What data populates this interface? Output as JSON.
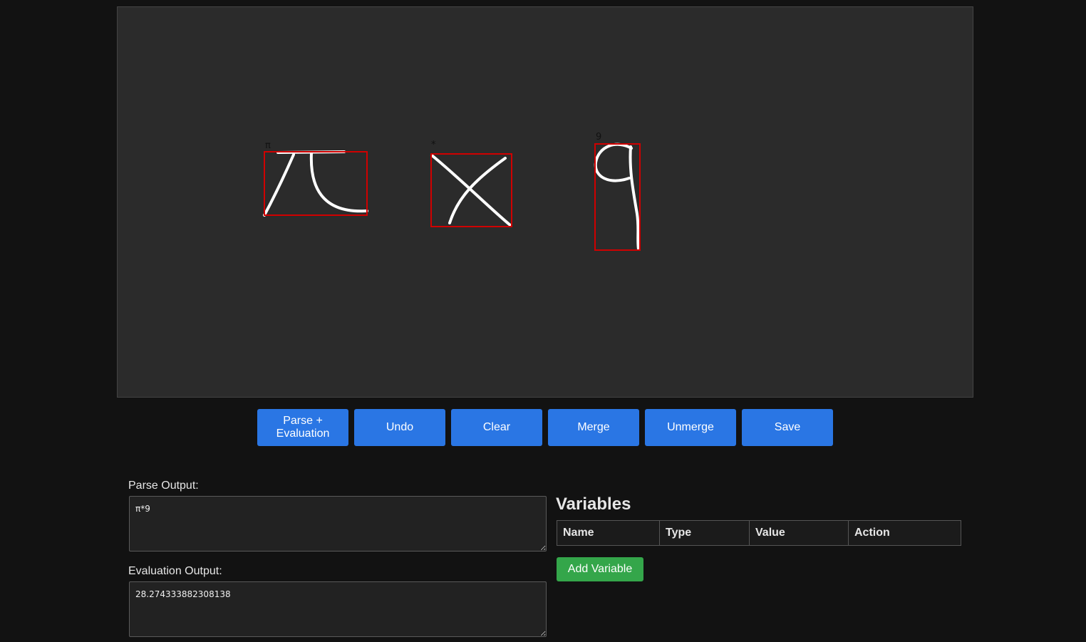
{
  "canvas": {
    "symbols": [
      {
        "predicted_label": "π",
        "name": "pi"
      },
      {
        "predicted_label": "*",
        "name": "multiply"
      },
      {
        "predicted_label": "9",
        "name": "nine"
      }
    ],
    "bbox_color": "#d00000",
    "stroke_color": "#ffffff"
  },
  "toolbar": {
    "parse_label": "Parse +\nEvaluation",
    "undo_label": "Undo",
    "clear_label": "Clear",
    "merge_label": "Merge",
    "unmerge_label": "Unmerge",
    "save_label": "Save"
  },
  "parse": {
    "label": "Parse Output:",
    "value": "π*9"
  },
  "evaluation": {
    "label": "Evaluation Output:",
    "value": "28.274333882308138"
  },
  "variables": {
    "title": "Variables",
    "columns": [
      "Name",
      "Type",
      "Value",
      "Action"
    ],
    "add_label": "Add Variable"
  },
  "colors": {
    "primary_button": "#2a76e4",
    "add_button": "#34a64a",
    "background": "#121212",
    "canvas_background": "#2b2b2b"
  }
}
